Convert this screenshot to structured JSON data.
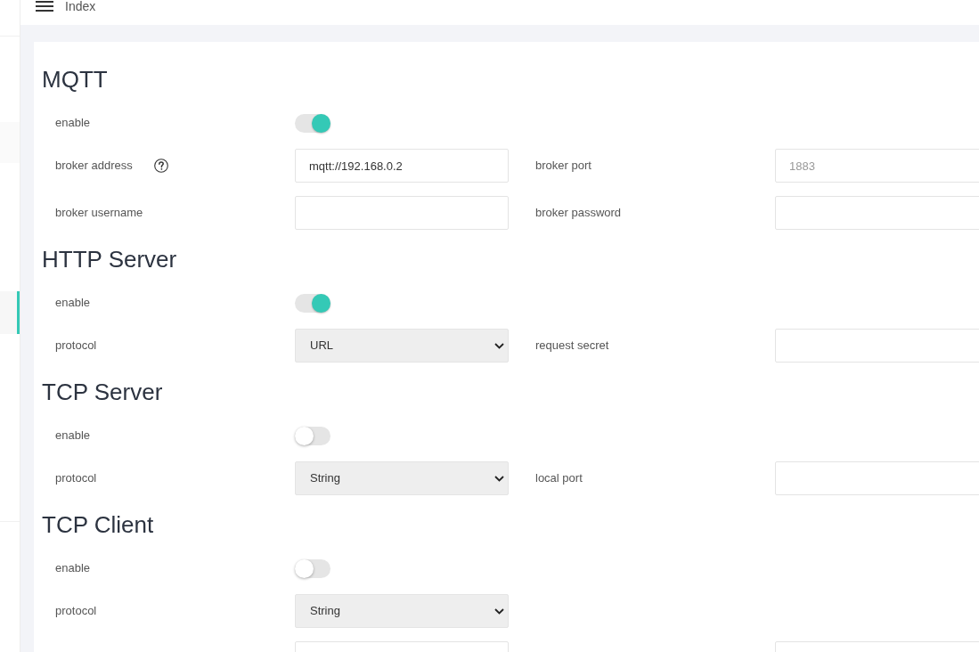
{
  "header": {
    "title": "Index"
  },
  "sidebar": {
    "items": [
      {
        "selected": false
      },
      {
        "selected": true
      }
    ]
  },
  "sections": [
    {
      "title": "MQTT",
      "rows": [
        {
          "fields": [
            {
              "kind": "switch",
              "label": "enable",
              "on": true
            }
          ]
        },
        {
          "fields": [
            {
              "kind": "input",
              "label": "broker address",
              "help": true,
              "value": "mqtt://192.168.0.2"
            },
            {
              "kind": "input",
              "label": "broker port",
              "placeholder": "1883"
            }
          ]
        },
        {
          "fields": [
            {
              "kind": "input",
              "label": "broker username"
            },
            {
              "kind": "input",
              "label": "broker password"
            }
          ]
        }
      ]
    },
    {
      "title": "HTTP Server",
      "rows": [
        {
          "fields": [
            {
              "kind": "switch",
              "label": "enable",
              "on": true
            }
          ]
        },
        {
          "fields": [
            {
              "kind": "select",
              "label": "protocol",
              "value": "URL"
            },
            {
              "kind": "input",
              "label": "request secret"
            }
          ]
        }
      ]
    },
    {
      "title": "TCP Server",
      "rows": [
        {
          "fields": [
            {
              "kind": "switch",
              "label": "enable",
              "on": false
            }
          ]
        },
        {
          "fields": [
            {
              "kind": "select",
              "label": "protocol",
              "value": "String"
            },
            {
              "kind": "input",
              "label": "local port"
            }
          ]
        }
      ]
    },
    {
      "title": "TCP Client",
      "rows": [
        {
          "fields": [
            {
              "kind": "switch",
              "label": "enable",
              "on": false
            }
          ]
        },
        {
          "fields": [
            {
              "kind": "select",
              "label": "protocol",
              "value": "String"
            }
          ]
        },
        {
          "fields": [
            {
              "kind": "input"
            },
            {
              "kind": "input"
            }
          ]
        }
      ]
    }
  ]
}
